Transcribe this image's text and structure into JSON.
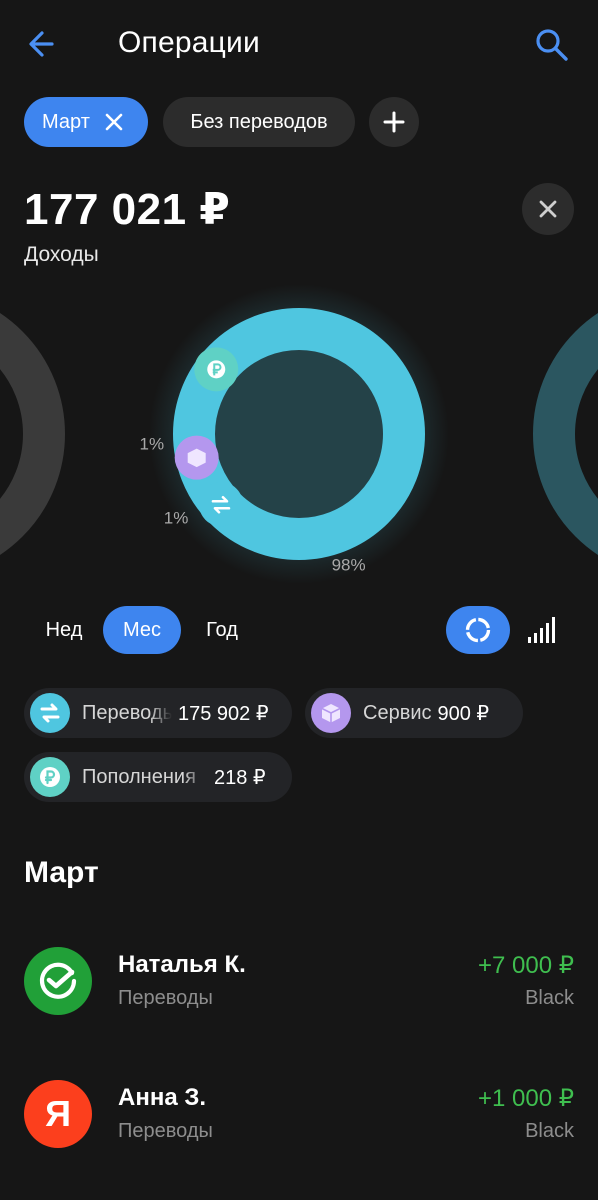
{
  "header": {
    "title": "Операции",
    "back_icon": "arrow-left-icon",
    "search_icon": "search-icon"
  },
  "filters": {
    "month_chip": "Март",
    "no_transfers_chip": "Без переводов",
    "add_icon": "plus-icon"
  },
  "summary": {
    "total": "177 021 ₽",
    "label": "Доходы"
  },
  "chart_data": {
    "type": "pie",
    "style": "donut",
    "title": "",
    "categories": [
      "Переводы",
      "Сервис",
      "Пополнения"
    ],
    "values": [
      175902,
      900,
      218
    ],
    "percent_labels": [
      "98%",
      "1%",
      "1%"
    ],
    "colors": [
      "#4fc6e0",
      "#b497ee",
      "#5fd1c5"
    ]
  },
  "period_tabs": [
    "Нед",
    "Мес",
    "Год"
  ],
  "selected_period": "Мес",
  "view_toggle": {
    "donut_icon": "donut-chart-icon",
    "bars_icon": "bar-chart-icon",
    "selected": "donut"
  },
  "categories": [
    {
      "name": "Переводы",
      "amount": "175 902 ₽",
      "icon": "transfer-arrows-icon",
      "color": "#4fc6e0"
    },
    {
      "name": "Сервис",
      "amount": "900 ₽",
      "icon": "box-icon",
      "color": "#b497ee"
    },
    {
      "name": "Пополнения",
      "amount": "218 ₽",
      "icon": "ruble-icon",
      "color": "#5fd1c5"
    }
  ],
  "section_title": "Март",
  "transactions": [
    {
      "name": "Наталья К.",
      "category": "Переводы",
      "amount": "+7 000 ₽",
      "card": "Black",
      "avatar_icon": "sber-check-icon",
      "avatar_color": "#21a038"
    },
    {
      "name": "Анна З.",
      "category": "Переводы",
      "amount": "+1 000 ₽",
      "card": "Black",
      "avatar_icon": "yandex-icon",
      "avatar_color": "#fc3f1d",
      "avatar_letter": "Я"
    }
  ]
}
